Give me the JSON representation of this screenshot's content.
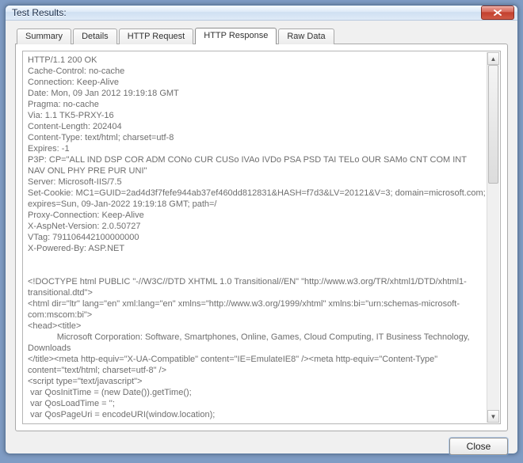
{
  "window": {
    "title": "Test Results:"
  },
  "tabs": [
    {
      "label": "Summary"
    },
    {
      "label": "Details"
    },
    {
      "label": "HTTP Request"
    },
    {
      "label": "HTTP Response"
    },
    {
      "label": "Raw Data"
    }
  ],
  "active_tab_index": 3,
  "response_body": "HTTP/1.1 200 OK\nCache-Control: no-cache\nConnection: Keep-Alive\nDate: Mon, 09 Jan 2012 19:19:18 GMT\nPragma: no-cache\nVia: 1.1 TK5-PRXY-16\nContent-Length: 202404\nContent-Type: text/html; charset=utf-8\nExpires: -1\nP3P: CP=\"ALL IND DSP COR ADM CONo CUR CUSo IVAo IVDo PSA PSD TAI TELo OUR SAMo CNT COM INT NAV ONL PHY PRE PUR UNI\"\nServer: Microsoft-IIS/7.5\nSet-Cookie: MC1=GUID=2ad4d3f7fefe944ab37ef460dd812831&HASH=f7d3&LV=20121&V=3; domain=microsoft.com; expires=Sun, 09-Jan-2022 19:19:18 GMT; path=/\nProxy-Connection: Keep-Alive\nX-AspNet-Version: 2.0.50727\nVTag: 791106442100000000\nX-Powered-By: ASP.NET\n\n\n<!DOCTYPE html PUBLIC \"-//W3C//DTD XHTML 1.0 Transitional//EN\" \"http://www.w3.org/TR/xhtml1/DTD/xhtml1-transitional.dtd\">\n<html dir=\"ltr\" lang=\"en\" xml:lang=\"en\" xmlns=\"http://www.w3.org/1999/xhtml\" xmlns:bi=\"urn:schemas-microsoft-com:mscom:bi\">\n<head><title>\n            Microsoft Corporation: Software, Smartphones, Online, Games, Cloud Computing, IT Business Technology, Downloads\n</title><meta http-equiv=\"X-UA-Compatible\" content=\"IE=EmulateIE8\" /><meta http-equiv=\"Content-Type\" content=\"text/html; charset=utf-8\" />\n<script type=\"text/javascript\">\n var QosInitTime = (new Date()).getTime();\n var QosLoadTime = '';\n var QosPageUri = encodeURI(window.location);",
  "buttons": {
    "close": "Close"
  }
}
